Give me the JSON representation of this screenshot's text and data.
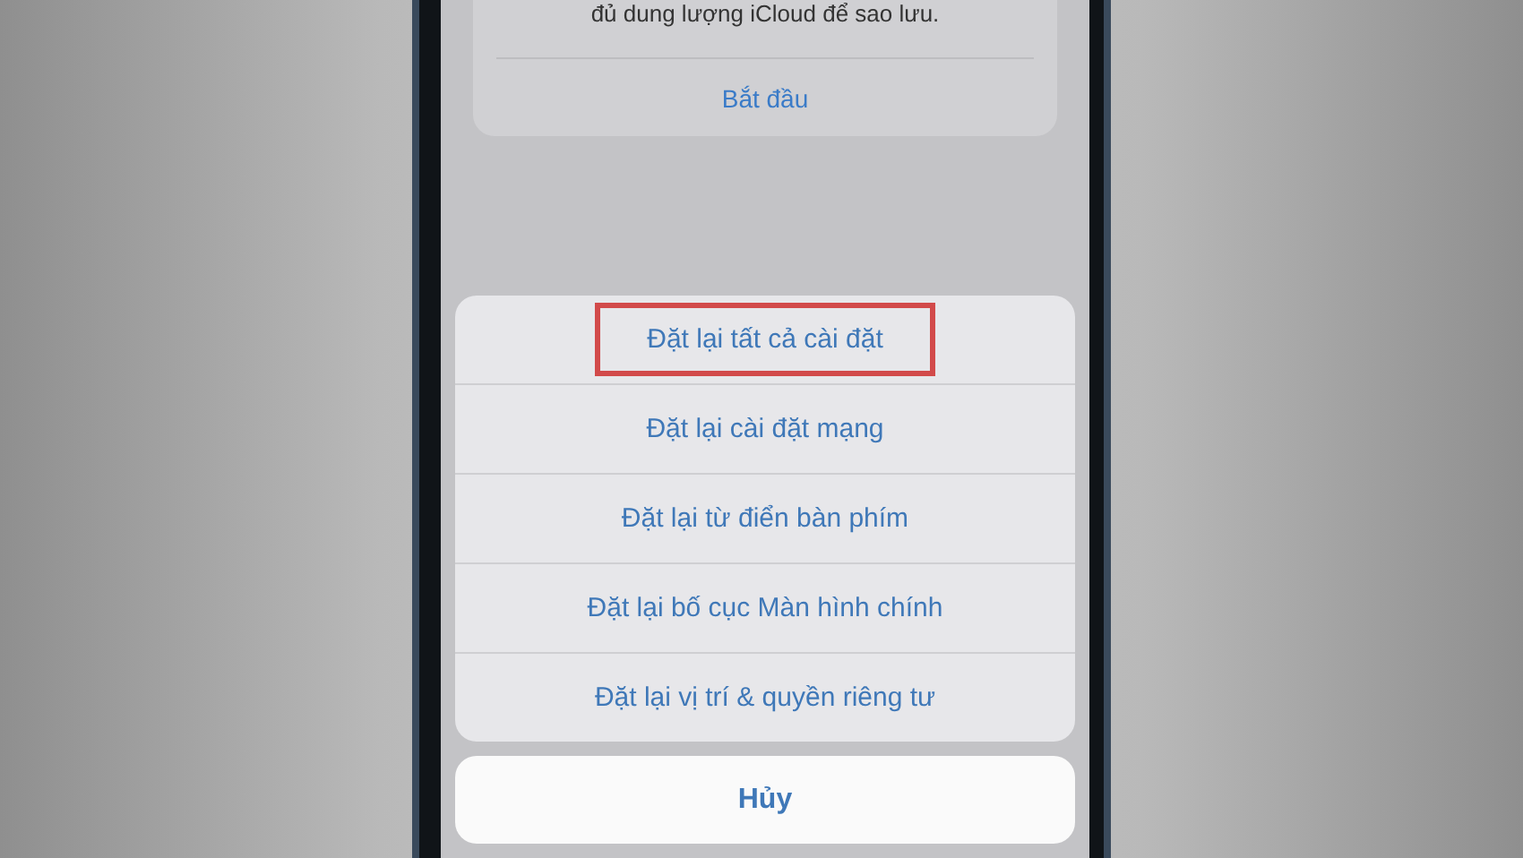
{
  "backup_card": {
    "message": "đủ dung lượng iCloud để sao lưu.",
    "action": "Bắt đầu"
  },
  "action_sheet": {
    "options": [
      {
        "label": "Đặt lại tất cả cài đặt",
        "highlighted": true
      },
      {
        "label": "Đặt lại cài đặt mạng",
        "highlighted": false
      },
      {
        "label": "Đặt lại từ điển bàn phím",
        "highlighted": false
      },
      {
        "label": "Đặt lại bố cục Màn hình chính",
        "highlighted": false
      },
      {
        "label": "Đặt lại vị trí & quyền riêng tư",
        "highlighted": false
      }
    ],
    "cancel": "Hủy"
  }
}
